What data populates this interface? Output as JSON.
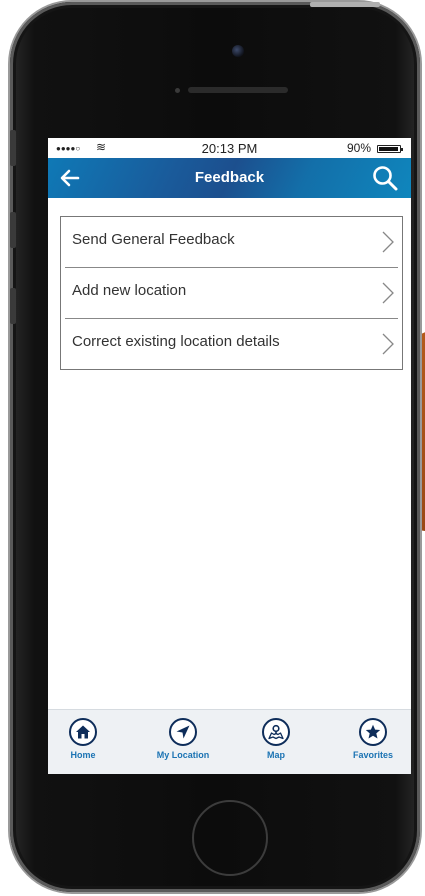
{
  "status_bar": {
    "signal": "●●●●○",
    "wifi": "≋",
    "time": "20:13 PM",
    "battery": "90%"
  },
  "nav": {
    "title": "Feedback",
    "back_icon": "arrow-left-icon",
    "search_icon": "search-icon"
  },
  "menu": {
    "items": [
      {
        "label": "Send General Feedback"
      },
      {
        "label": "Add new location"
      },
      {
        "label": "Correct existing location details"
      }
    ]
  },
  "tabs": {
    "items": [
      {
        "label": "Home",
        "icon": "home-icon"
      },
      {
        "label": "My Location",
        "icon": "location-arrow-icon"
      },
      {
        "label": "Map",
        "icon": "map-icon"
      },
      {
        "label": "Favorites",
        "icon": "star-icon"
      }
    ]
  },
  "colors": {
    "nav_bar": "#1a5a9a",
    "tab_label": "#1b73b3",
    "tab_icon": "#0e2d5a"
  }
}
